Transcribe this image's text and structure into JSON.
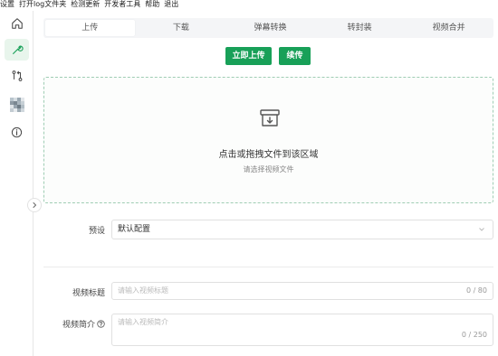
{
  "menubar": {
    "items": [
      "设置",
      "打开log文件夹",
      "检测更新",
      "开发者工具",
      "帮助",
      "退出"
    ]
  },
  "sidebar": {
    "items": [
      {
        "icon": "home-icon"
      },
      {
        "icon": "wrench-icon",
        "active": true
      },
      {
        "icon": "git-compare-icon"
      },
      {
        "icon": "avatar-icon"
      },
      {
        "icon": "info-icon"
      }
    ],
    "collapse_icon": "chevron-right-icon"
  },
  "tabs": [
    {
      "label": "上传",
      "active": true
    },
    {
      "label": "下载"
    },
    {
      "label": "弹幕转换"
    },
    {
      "label": "转封装"
    },
    {
      "label": "视频合并"
    }
  ],
  "actions": {
    "upload_now": "立即上传",
    "resume": "续传"
  },
  "dropzone": {
    "icon": "archive-download-icon",
    "title": "点击或拖拽文件到该区域",
    "subtitle": "请选择视频文件"
  },
  "preset": {
    "label": "预设",
    "value": "默认配置"
  },
  "title_field": {
    "label": "视频标题",
    "placeholder": "请输入视频标题",
    "counter": "0 / 80"
  },
  "desc_field": {
    "label": "视频简介",
    "placeholder": "请输入视频简介",
    "counter": "0 / 250"
  },
  "colors": {
    "accent": "#18a058"
  }
}
